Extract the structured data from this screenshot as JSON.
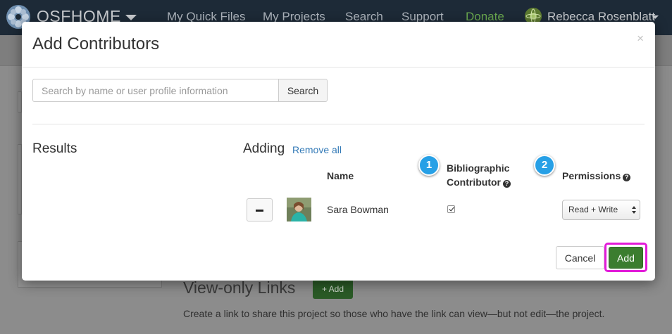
{
  "navbar": {
    "brand": "OSFHOME",
    "links": [
      "My Quick Files",
      "My Projects",
      "Search",
      "Support",
      "Donate"
    ],
    "user_name": "Rebecca Rosenblatt"
  },
  "background": {
    "view_only_title": "View-only Links",
    "view_only_add": "+ Add",
    "view_only_desc": "Create a link to share this project so those who have the link can view—but not edit—the project."
  },
  "modal": {
    "title": "Add Contributors",
    "close": "×",
    "search": {
      "placeholder": "Search by name or user profile information",
      "value": "",
      "button": "Search"
    },
    "results_title": "Results",
    "adding_title": "Adding",
    "remove_all": "Remove all",
    "columns": {
      "name": "Name",
      "biblio_line1": "Bibliographic",
      "biblio_line2": "Contributor",
      "permissions": "Permissions"
    },
    "steps": [
      "1",
      "2"
    ],
    "contributor": {
      "name": "Sara Bowman",
      "bibliographic": true,
      "permission": "Read + Write"
    },
    "cancel": "Cancel",
    "add": "Add"
  },
  "colors": {
    "navbar": "#1d2a37",
    "accent_blue": "#27a0e6",
    "add_green": "#3b7d2f",
    "highlight_magenta": "#e21bd9",
    "link": "#337ab7"
  }
}
